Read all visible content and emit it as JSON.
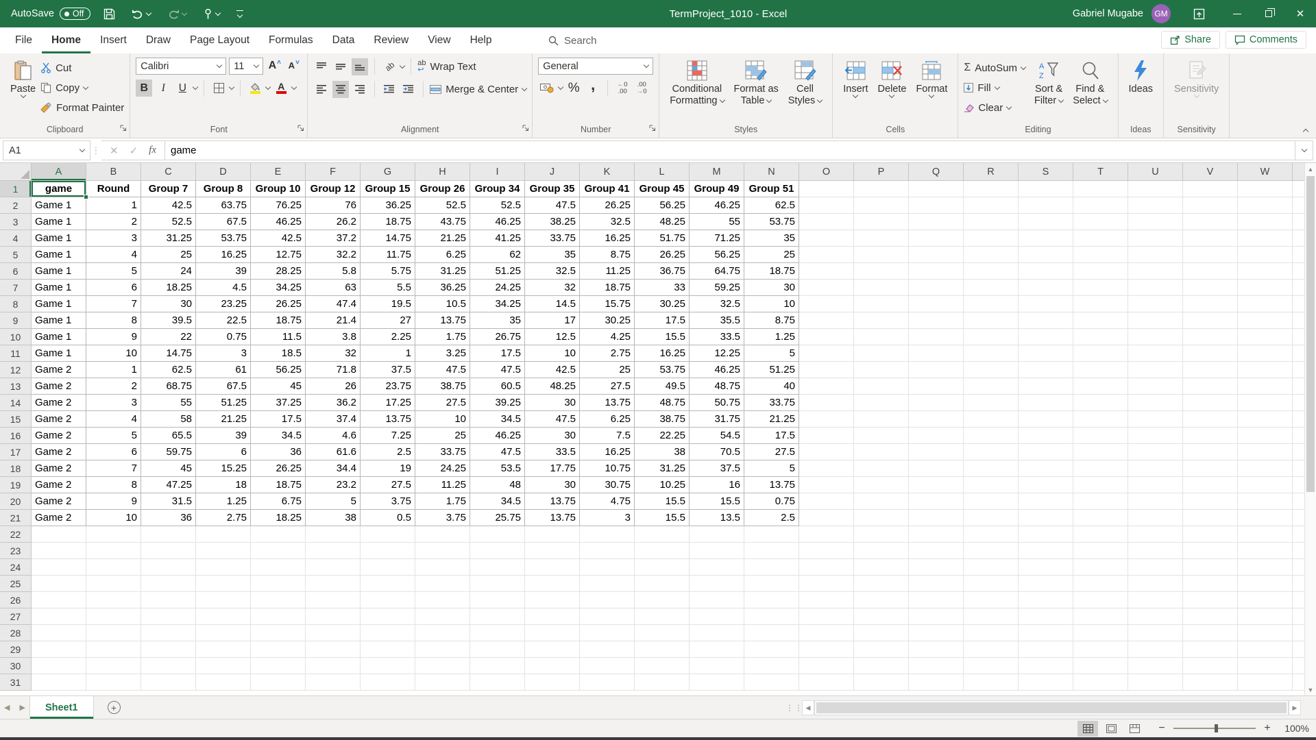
{
  "titlebar": {
    "autosave_label": "AutoSave",
    "autosave_state": "Off",
    "title": "TermProject_1010  -  Excel",
    "user_name": "Gabriel Mugabe",
    "user_initials": "GM"
  },
  "menubar": {
    "tabs": [
      "File",
      "Home",
      "Insert",
      "Draw",
      "Page Layout",
      "Formulas",
      "Data",
      "Review",
      "View",
      "Help"
    ],
    "active_tab": "Home",
    "search_label": "Search",
    "share_label": "Share",
    "comments_label": "Comments"
  },
  "ribbon": {
    "clipboard": {
      "label": "Clipboard",
      "paste": "Paste",
      "cut": "Cut",
      "copy": "Copy",
      "format_painter": "Format Painter"
    },
    "font": {
      "label": "Font",
      "font_name": "Calibri",
      "font_size": "11",
      "bold": "B",
      "italic": "I",
      "underline": "U"
    },
    "alignment": {
      "label": "Alignment",
      "wrap_text": "Wrap Text",
      "merge_center": "Merge & Center"
    },
    "number": {
      "label": "Number",
      "format": "General"
    },
    "styles": {
      "label": "Styles",
      "conditional_line1": "Conditional",
      "conditional_line2": "Formatting",
      "table_line1": "Format as",
      "table_line2": "Table",
      "cellstyles_line1": "Cell",
      "cellstyles_line2": "Styles"
    },
    "cells": {
      "label": "Cells",
      "insert": "Insert",
      "delete": "Delete",
      "format": "Format"
    },
    "editing": {
      "label": "Editing",
      "autosum": "AutoSum",
      "fill": "Fill",
      "clear": "Clear",
      "sort_line1": "Sort &",
      "sort_line2": "Filter",
      "find_line1": "Find &",
      "find_line2": "Select"
    },
    "ideas": {
      "label": "Ideas",
      "button": "Ideas"
    },
    "sensitivity": {
      "label": "Sensitivity",
      "button": "Sensitivity"
    }
  },
  "formula_bar": {
    "name_box": "A1",
    "fx": "fx",
    "value": "game"
  },
  "sheet": {
    "columns": [
      "A",
      "B",
      "C",
      "D",
      "E",
      "F",
      "G",
      "H",
      "I",
      "J",
      "K",
      "L",
      "M",
      "N",
      "O",
      "P",
      "Q",
      "R",
      "S",
      "T",
      "U",
      "V",
      "W"
    ],
    "rows_visible": 31,
    "selected_cell": "A1",
    "selected_column": "A",
    "selected_row": 1,
    "header_row": [
      "game",
      "Round",
      "Group 7",
      "Group 8",
      "Group 10",
      "Group 12",
      "Group 15",
      "Group 26",
      "Group 34",
      "Group 35",
      "Group 41",
      "Group 45",
      "Group 49",
      "Group 51"
    ],
    "data_rows": [
      [
        "Game 1",
        1,
        42.5,
        63.75,
        76.25,
        76,
        36.25,
        52.5,
        52.5,
        47.5,
        26.25,
        56.25,
        46.25,
        62.5
      ],
      [
        "Game 1",
        2,
        52.5,
        67.5,
        46.25,
        26.2,
        18.75,
        43.75,
        46.25,
        38.25,
        32.5,
        48.25,
        55,
        53.75
      ],
      [
        "Game 1",
        3,
        31.25,
        53.75,
        42.5,
        37.2,
        14.75,
        21.25,
        41.25,
        33.75,
        16.25,
        51.75,
        71.25,
        35
      ],
      [
        "Game 1",
        4,
        25,
        16.25,
        12.75,
        32.2,
        11.75,
        6.25,
        62,
        35,
        8.75,
        26.25,
        56.25,
        25
      ],
      [
        "Game 1",
        5,
        24,
        39,
        28.25,
        5.8,
        5.75,
        31.25,
        51.25,
        32.5,
        11.25,
        36.75,
        64.75,
        18.75
      ],
      [
        "Game 1",
        6,
        18.25,
        4.5,
        34.25,
        63,
        5.5,
        36.25,
        24.25,
        32,
        18.75,
        33,
        59.25,
        30
      ],
      [
        "Game 1",
        7,
        30,
        23.25,
        26.25,
        47.4,
        19.5,
        10.5,
        34.25,
        14.5,
        15.75,
        30.25,
        32.5,
        10
      ],
      [
        "Game 1",
        8,
        39.5,
        22.5,
        18.75,
        21.4,
        27,
        13.75,
        35,
        17,
        30.25,
        17.5,
        35.5,
        8.75
      ],
      [
        "Game 1",
        9,
        22,
        0.75,
        11.5,
        3.8,
        2.25,
        1.75,
        26.75,
        12.5,
        4.25,
        15.5,
        33.5,
        1.25
      ],
      [
        "Game 1",
        10,
        14.75,
        3,
        18.5,
        32,
        1,
        3.25,
        17.5,
        10,
        2.75,
        16.25,
        12.25,
        5
      ],
      [
        "Game 2",
        1,
        62.5,
        61,
        56.25,
        71.8,
        37.5,
        47.5,
        47.5,
        42.5,
        25,
        53.75,
        46.25,
        51.25
      ],
      [
        "Game 2",
        2,
        68.75,
        67.5,
        45,
        26,
        23.75,
        38.75,
        60.5,
        48.25,
        27.5,
        49.5,
        48.75,
        40
      ],
      [
        "Game 2",
        3,
        55,
        51.25,
        37.25,
        36.2,
        17.25,
        27.5,
        39.25,
        30,
        13.75,
        48.75,
        50.75,
        33.75
      ],
      [
        "Game 2",
        4,
        58,
        21.25,
        17.5,
        37.4,
        13.75,
        10,
        34.5,
        47.5,
        6.25,
        38.75,
        31.75,
        21.25
      ],
      [
        "Game 2",
        5,
        65.5,
        39,
        34.5,
        4.6,
        7.25,
        25,
        46.25,
        30,
        7.5,
        22.25,
        54.5,
        17.5
      ],
      [
        "Game 2",
        6,
        59.75,
        6,
        36,
        61.6,
        2.5,
        33.75,
        47.5,
        33.5,
        16.25,
        38,
        70.5,
        27.5
      ],
      [
        "Game 2",
        7,
        45,
        15.25,
        26.25,
        34.4,
        19,
        24.25,
        53.5,
        17.75,
        10.75,
        31.25,
        37.5,
        5
      ],
      [
        "Game 2",
        8,
        47.25,
        18,
        18.75,
        23.2,
        27.5,
        11.25,
        48,
        30,
        30.75,
        10.25,
        16,
        13.75
      ],
      [
        "Game 2",
        9,
        31.5,
        1.25,
        6.75,
        5,
        3.75,
        1.75,
        34.5,
        13.75,
        4.75,
        15.5,
        15.5,
        0.75
      ],
      [
        "Game 2",
        10,
        36,
        2.75,
        18.25,
        38,
        0.5,
        3.75,
        25.75,
        13.75,
        3,
        15.5,
        13.5,
        2.5
      ]
    ]
  },
  "tabs_bar": {
    "sheet_name": "Sheet1"
  },
  "status_bar": {
    "zoom_level": "100%"
  },
  "colors": {
    "excel_green": "#217346",
    "avatar_purple": "#9a63b5",
    "accent_blue": "#2b7cd3"
  }
}
